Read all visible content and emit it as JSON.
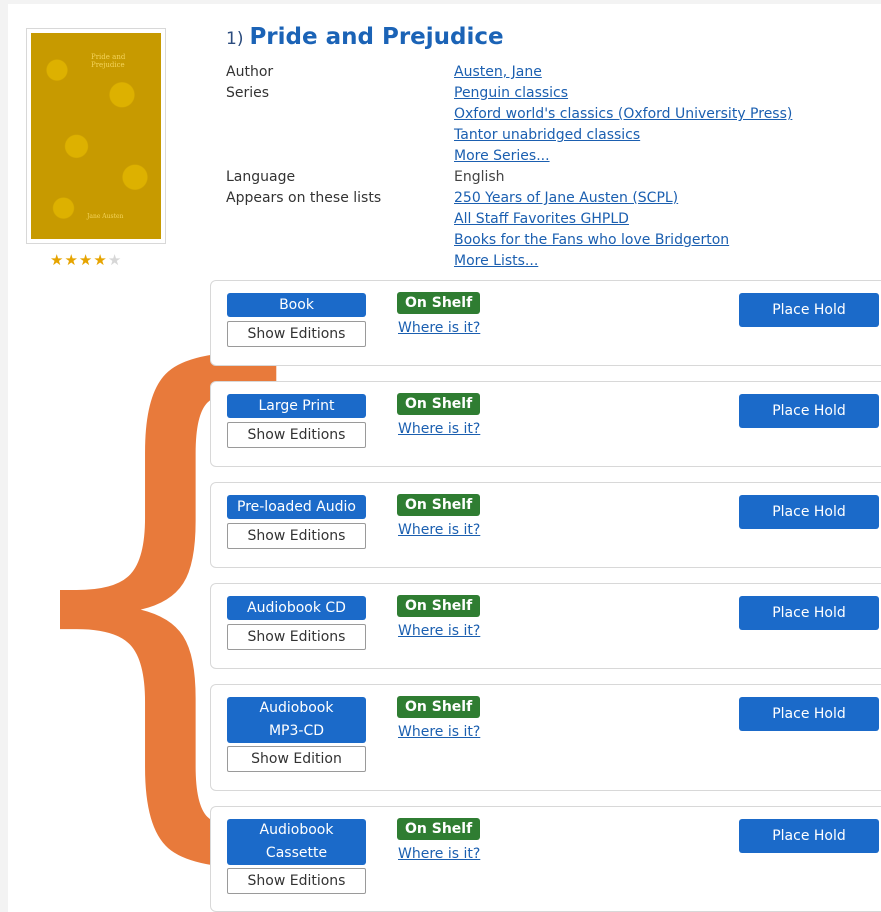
{
  "title_number": "1)",
  "title": "Pride and Prejudice",
  "cover": {
    "line1": "Pride and",
    "line2": "Prejudice",
    "author": "Jane Austen"
  },
  "rating": {
    "stars": 4.5,
    "max": 5
  },
  "metadata": {
    "author_label": "Author",
    "author": "Austen, Jane",
    "series_label": "Series",
    "series": [
      "Penguin classics",
      "Oxford world's classics (Oxford University Press)",
      "Tantor unabridged classics",
      "More Series..."
    ],
    "language_label": "Language",
    "language": "English",
    "lists_label": "Appears on these lists",
    "lists": [
      "250 Years of Jane Austen (SCPL)",
      "All Staff Favorites GHPLD",
      "Books for the Fans who love Bridgerton",
      "More Lists..."
    ]
  },
  "annotation": {
    "glyph": "{",
    "color": "#e87a3b"
  },
  "formats": [
    {
      "label": "Book",
      "editions_label": "Show Editions",
      "status": "On Shelf",
      "where": "Where is it?",
      "hold": "Place Hold"
    },
    {
      "label": "Large Print",
      "editions_label": "Show Editions",
      "status": "On Shelf",
      "where": "Where is it?",
      "hold": "Place Hold"
    },
    {
      "label": "Pre-loaded Audio",
      "editions_label": "Show Editions",
      "status": "On Shelf",
      "where": "Where is it?",
      "hold": "Place Hold"
    },
    {
      "label": "Audiobook CD",
      "editions_label": "Show Editions",
      "status": "On Shelf",
      "where": "Where is it?",
      "hold": "Place Hold"
    },
    {
      "label": "Audiobook MP3-CD",
      "editions_label": "Show Edition",
      "status": "On Shelf",
      "where": "Where is it?",
      "hold": "Place Hold"
    },
    {
      "label": "Audiobook Cassette",
      "editions_label": "Show Editions",
      "status": "On Shelf",
      "where": "Where is it?",
      "hold": "Place Hold"
    }
  ],
  "colors": {
    "primary_button": "#1b6ac9",
    "on_shelf_badge": "#2f7d32",
    "link": "#1b5fb0",
    "title": "#1b63b6"
  }
}
